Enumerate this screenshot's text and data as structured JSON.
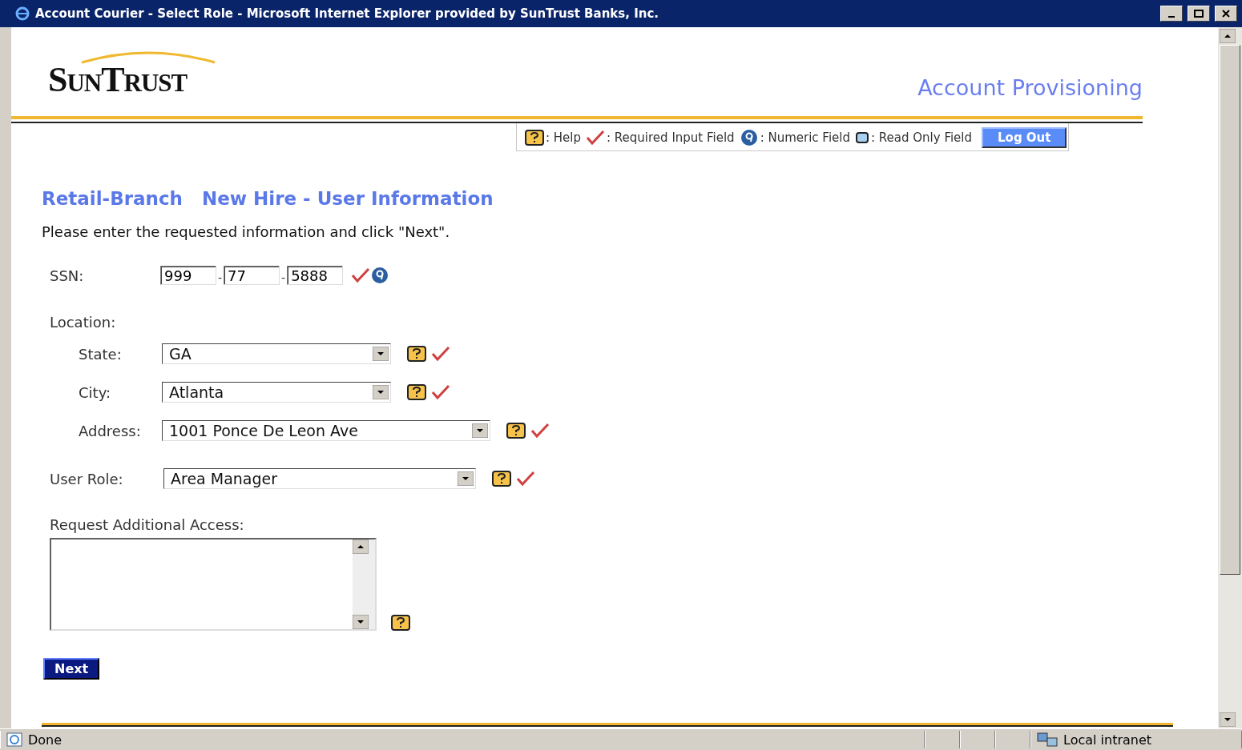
{
  "window": {
    "title": "Account Courier - Select Role - Microsoft Internet Explorer provided by SunTrust Banks, Inc."
  },
  "header": {
    "logo": "SunTrust",
    "app_title": "Account Provisioning"
  },
  "legend": [
    {
      "kind": "help",
      "label": ": Help"
    },
    {
      "kind": "required",
      "label": ": Required Input Field"
    },
    {
      "kind": "numeric",
      "label": ": Numeric Field"
    },
    {
      "kind": "readonly",
      "label": ": Read Only Field"
    }
  ],
  "logout_button": "Log Out",
  "breadcrumb": [
    "Retail-Branch",
    "New Hire - User Information"
  ],
  "instruction": "Please enter the requested information and click \"Next\".",
  "ssn": {
    "label": "SSN:",
    "parts": [
      "999",
      "77",
      "5888"
    ],
    "separators": [
      "-",
      "-"
    ],
    "required": true,
    "numeric": true
  },
  "location": {
    "label": "Location:",
    "fields": [
      {
        "label": "State:",
        "value": "GA",
        "help": true,
        "required": true
      },
      {
        "label": "City:",
        "value": "Atlanta",
        "help": true,
        "required": true
      },
      {
        "label": "Address:",
        "value": "1001 Ponce De Leon Ave",
        "help": true,
        "required": true
      }
    ]
  },
  "user_role": {
    "label": "User Role:",
    "value": "Area Manager",
    "help": true,
    "required": true
  },
  "additional_access": {
    "label": "Request Additional Access:",
    "help": true
  },
  "next_button": "Next",
  "status_bar": {
    "status": "Done",
    "zone": "Local intranet"
  }
}
